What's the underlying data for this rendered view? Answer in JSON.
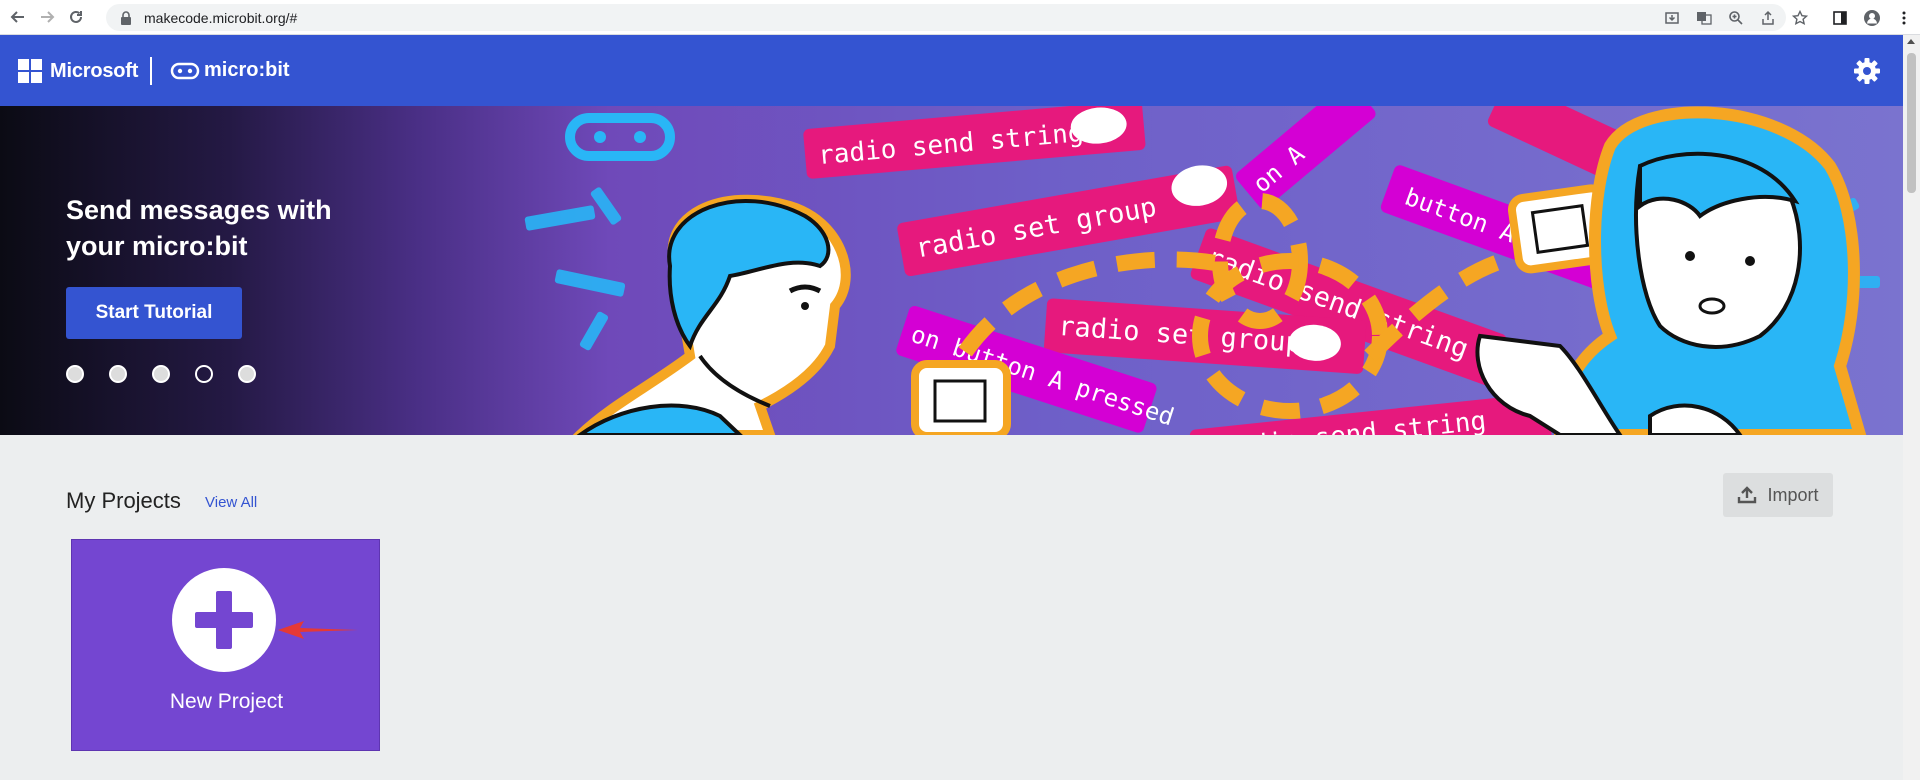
{
  "browser": {
    "url": "makecode.microbit.org/#"
  },
  "header": {
    "brand": "Microsoft",
    "product": "micro:bit",
    "settings_icon": "gear-icon"
  },
  "hero": {
    "title": "Send messages with your micro:bit",
    "button_label": "Start Tutorial",
    "active_slide": 4,
    "slide_count": 5,
    "art_blocks": [
      "radio send string",
      "radio set group",
      "radio send string",
      "radio set group",
      "on button A pressed",
      "button A",
      "radio send string",
      "on A"
    ]
  },
  "projects": {
    "title": "My Projects",
    "view_all": "View All",
    "import_label": "Import",
    "new_project_label": "New Project"
  },
  "colors": {
    "header": "#3454d1",
    "new_project_card": "#7446d1",
    "block_pink": "#e6197d",
    "block_magenta": "#d400d4",
    "accent_orange": "#f5a623"
  }
}
